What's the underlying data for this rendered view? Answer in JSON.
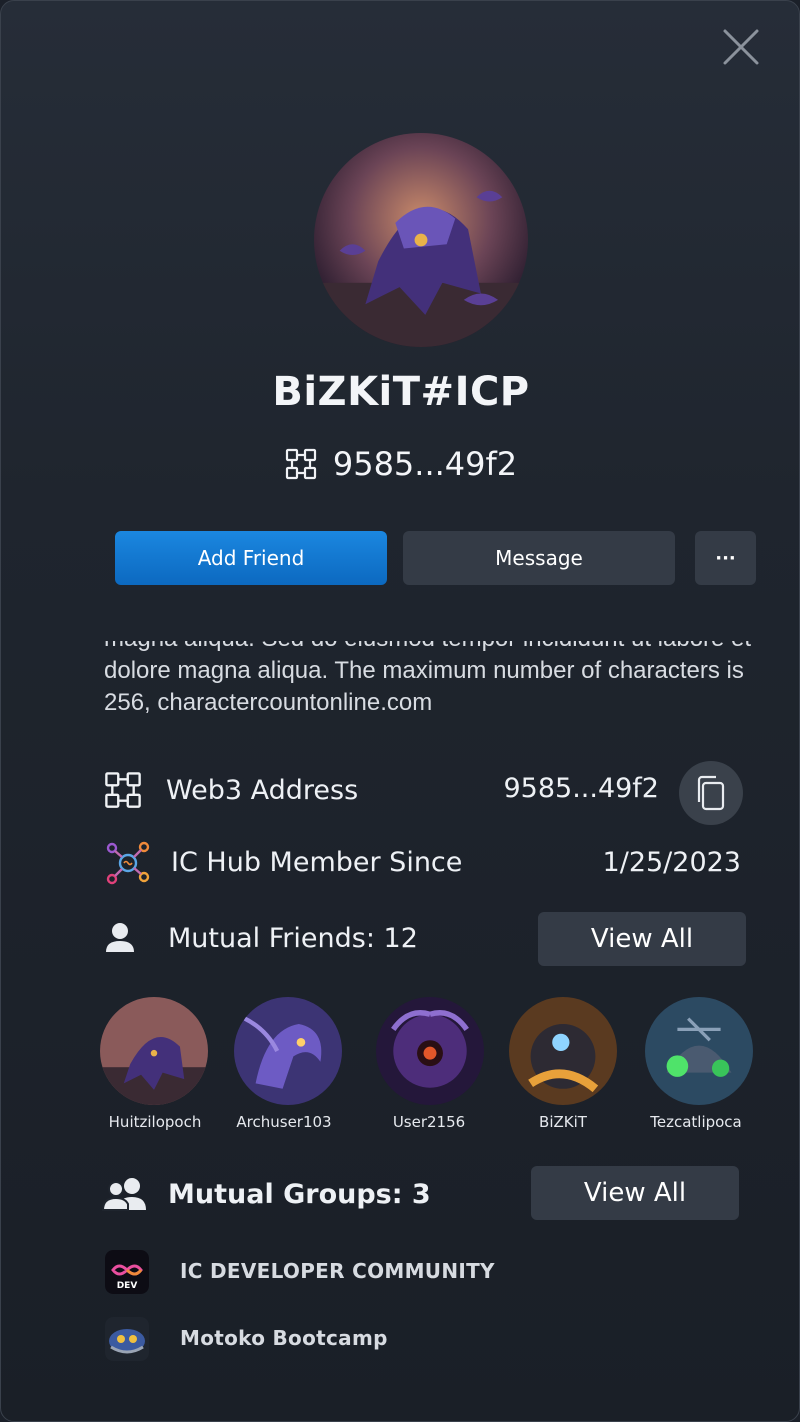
{
  "profile": {
    "username": "BiZKiT#ICP",
    "short_address": "9585...49f2",
    "bio": "magna aliqua. Sed do eiusmod tempor incididunt ut labore et dolore magna aliqua. The maximum number of characters is 256, charactercountonline.com"
  },
  "actions": {
    "add_friend": "Add Friend",
    "message": "Message",
    "more": "···"
  },
  "details": {
    "web3_label": "Web3 Address",
    "web3_value": "9585...49f2",
    "member_label": "IC Hub Member Since",
    "member_value": "1/25/2023"
  },
  "mutual_friends": {
    "label": "Mutual Friends: 12",
    "view_all": "View All",
    "friends": [
      {
        "name": "Huitzilopoch"
      },
      {
        "name": "Archuser103"
      },
      {
        "name": "User2156"
      },
      {
        "name": "BiZKiT"
      },
      {
        "name": "Tezcatlipoca"
      }
    ]
  },
  "mutual_groups": {
    "label": "Mutual Groups: 3",
    "view_all": "View All",
    "groups": [
      {
        "name": "IC DEVELOPER COMMUNITY",
        "icon_text": "DEV"
      },
      {
        "name": "Motoko Bootcamp"
      }
    ]
  },
  "colors": {
    "primary": "#1378d2",
    "panel_bg": "#1f252e",
    "button_secondary": "#343b46"
  },
  "icons": {
    "close": "close-icon",
    "address": "address-grid-icon",
    "copy": "copy-icon",
    "ic_hub": "ic-hub-icon",
    "friends": "user-icon",
    "groups": "users-icon"
  }
}
